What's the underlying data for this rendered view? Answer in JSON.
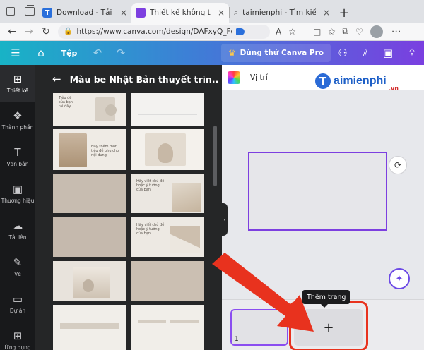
{
  "browser": {
    "tabs": [
      {
        "title": "Download - Tải Miễn Ph",
        "favicon_color": "#2a6fdb",
        "favicon_letter": "T",
        "active": false
      },
      {
        "title": "Thiết kế không tên - Bả",
        "favicon_color": "#7d3fe0",
        "active": true
      },
      {
        "title": "taimienphi - Tìm kiếm",
        "favicon_color": "#3d82f0",
        "active": false
      }
    ],
    "close_glyph": "×",
    "new_tab_glyph": "+",
    "url": "https://www.canva.com/design/DAFxyQ_Fc..."
  },
  "canva": {
    "file_label": "Tệp",
    "pro_label": "Dùng thử Canva Pro",
    "rail": [
      {
        "label": "Thiết kế",
        "icon": "layout-icon",
        "glyph": "⊞",
        "active": true
      },
      {
        "label": "Thành phần",
        "icon": "elements-icon",
        "glyph": "❖",
        "active": false
      },
      {
        "label": "Văn bản",
        "icon": "text-icon",
        "glyph": "T",
        "active": false
      },
      {
        "label": "Thương hiệu",
        "icon": "brand-icon",
        "glyph": "▣",
        "active": false
      },
      {
        "label": "Tải lên",
        "icon": "upload-icon",
        "glyph": "☁",
        "active": false
      },
      {
        "label": "Vẽ",
        "icon": "draw-icon",
        "glyph": "✎",
        "active": false
      },
      {
        "label": "Dự án",
        "icon": "folder-icon",
        "glyph": "▭",
        "active": false
      },
      {
        "label": "Ứng dụng",
        "icon": "apps-icon",
        "glyph": "⊞",
        "active": false
      }
    ],
    "panel_title": "Màu be Nhật Bản thuyết trìn...",
    "thumb_texts": [
      "Tiêu đề của bạn tại đây",
      "Hãy thêm một tiêu đề phụ cho nội dung",
      "Hãy viết chủ đề hoặc ý tưởng của bạn",
      "Hãy viết chủ đề hoặc ý tưởng của bạn"
    ],
    "editor": {
      "position_label": "Vị trí",
      "add_page_tooltip": "Thêm trang",
      "page_number": "1",
      "add_glyph": "+"
    }
  },
  "watermark": {
    "brand": "aimienphi",
    "brand_initial": "T",
    "suffix": ".vn"
  },
  "colors": {
    "canva_gradient_start": "#18b3c6",
    "canva_gradient_end": "#7a3fe0",
    "highlight_red": "#e8321e",
    "selection_purple": "#7d3fe0"
  }
}
